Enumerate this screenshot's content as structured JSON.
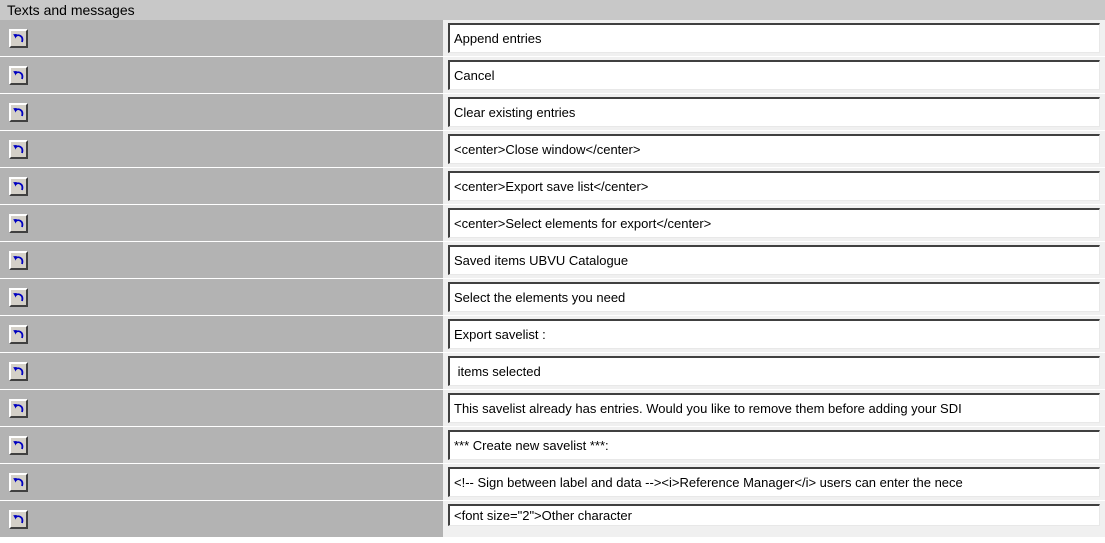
{
  "section": {
    "title": "Texts and messages"
  },
  "icons": {
    "undo": "undo-arrow-icon"
  },
  "colors": {
    "header_bg": "#c8c8c8",
    "label_bg": "#b3b3b3",
    "field_bg": "#ffffff",
    "icon_arrow": "#0000c0"
  },
  "entries": [
    {
      "value": "Append entries"
    },
    {
      "value": "Cancel"
    },
    {
      "value": "Clear existing entries"
    },
    {
      "value": "<center>Close window</center>"
    },
    {
      "value": "<center>Export save list</center>"
    },
    {
      "value": "<center>Select elements for export</center>"
    },
    {
      "value": "Saved items UBVU Catalogue"
    },
    {
      "value": "Select the elements you need"
    },
    {
      "value": "Export savelist :"
    },
    {
      "value": " items selected"
    },
    {
      "value": "This savelist already has entries. Would you like to remove them before adding your SDI"
    },
    {
      "value": "*** Create new savelist ***:"
    },
    {
      "value": "<!-- Sign between label and data --><i>Reference Manager</i> users can enter the nece"
    },
    {
      "value": "<font size=\"2\">Other character"
    }
  ]
}
